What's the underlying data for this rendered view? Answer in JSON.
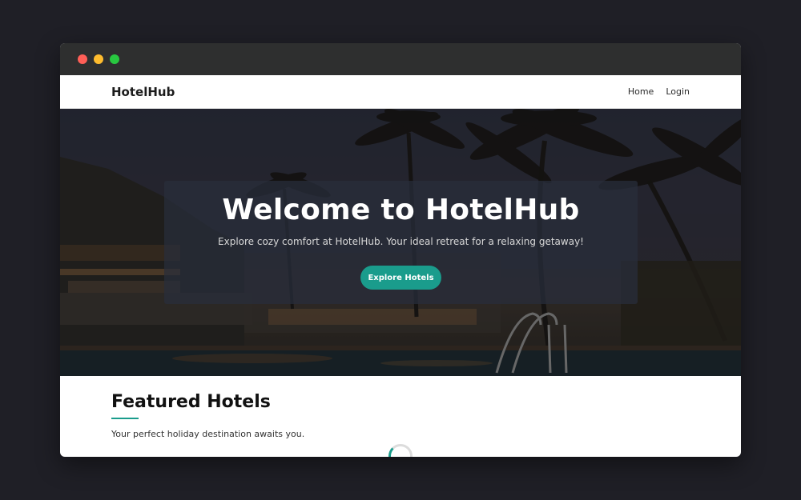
{
  "window": {
    "controls": [
      "close",
      "minimize",
      "maximize"
    ]
  },
  "navbar": {
    "brand": "HotelHub",
    "links": [
      {
        "label": "Home"
      },
      {
        "label": "Login"
      }
    ]
  },
  "hero": {
    "title": "Welcome to HotelHub",
    "subtitle": "Explore cozy comfort at HotelHub. Your ideal retreat for a relaxing getaway!",
    "cta_label": "Explore Hotels"
  },
  "featured": {
    "title": "Featured Hotels",
    "subtitle": "Your perfect holiday destination awaits you."
  },
  "colors": {
    "accent": "#1a9c8c",
    "page_background": "#1f1f26",
    "titlebar": "#2e2f2f"
  }
}
